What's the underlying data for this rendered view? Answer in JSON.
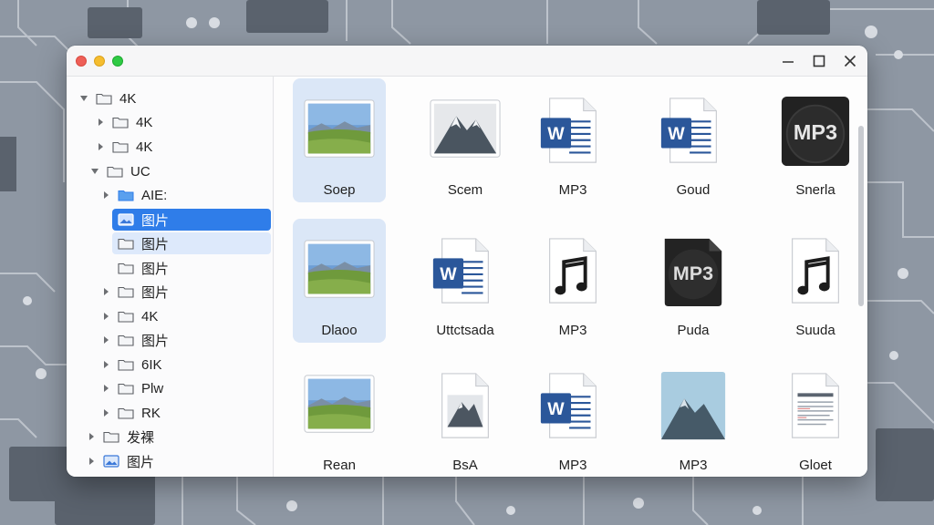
{
  "window": {
    "controls": {
      "minimize_icon": "minimize-icon",
      "maximize_icon": "maximize-icon",
      "close_icon": "close-icon"
    }
  },
  "sidebar": {
    "items": [
      {
        "label": "4K",
        "expanded": true,
        "arrow": "down",
        "icon": "folder-icon"
      },
      {
        "label": "4K",
        "arrow": "right",
        "icon": "folder-icon"
      },
      {
        "label": "4K",
        "arrow": "right",
        "icon": "folder-icon"
      },
      {
        "label": "UC",
        "expanded": true,
        "arrow": "down",
        "icon": "folder-icon"
      },
      {
        "label": "AIE:",
        "arrow": "right",
        "icon": "folder-blue-icon"
      },
      {
        "label": "图片",
        "selected": "primary",
        "icon": "image-folder-icon"
      },
      {
        "label": "图片",
        "selected": "secondary",
        "icon": "folder-icon"
      },
      {
        "label": "图片",
        "icon": "folder-icon"
      },
      {
        "label": "图片",
        "arrow": "right",
        "icon": "folder-icon"
      },
      {
        "label": "4K",
        "arrow": "right",
        "icon": "folder-icon"
      },
      {
        "label": "图片",
        "arrow": "right",
        "icon": "folder-icon"
      },
      {
        "label": "6IK",
        "arrow": "right",
        "icon": "folder-icon"
      },
      {
        "label": "Plw",
        "arrow": "right",
        "icon": "folder-icon"
      },
      {
        "label": "RK",
        "arrow": "right",
        "icon": "folder-icon"
      },
      {
        "label": "发裸",
        "arrow": "right",
        "icon": "folder-icon"
      },
      {
        "label": "图片",
        "arrow": "right",
        "icon": "image-folder-icon"
      }
    ]
  },
  "files": [
    {
      "label": "Soep",
      "kind": "landscape-photo",
      "selected": true
    },
    {
      "label": "Scem",
      "kind": "mountain-photo"
    },
    {
      "label": "MP3",
      "kind": "word-document"
    },
    {
      "label": "Goud",
      "kind": "word-document"
    },
    {
      "label": "Snerla",
      "kind": "mp3-badge"
    },
    {
      "label": "Dlaoo",
      "kind": "landscape-photo",
      "selected": true
    },
    {
      "label": "Uttctsada",
      "kind": "word-document"
    },
    {
      "label": "MP3",
      "kind": "music-file"
    },
    {
      "label": "Puda",
      "kind": "mp3-file"
    },
    {
      "label": "Suuda",
      "kind": "music-file"
    },
    {
      "label": "Rean",
      "kind": "landscape-photo"
    },
    {
      "label": "BsA",
      "kind": "mountain-file"
    },
    {
      "label": "MP3",
      "kind": "word-document"
    },
    {
      "label": "MP3",
      "kind": "mountain-flat"
    },
    {
      "label": "Gloet",
      "kind": "text-document"
    }
  ],
  "colors": {
    "selection": "#2f7de9",
    "selection_light": "#dbe7f7",
    "word_blue": "#2b579a",
    "mp3_dark": "#222222"
  }
}
